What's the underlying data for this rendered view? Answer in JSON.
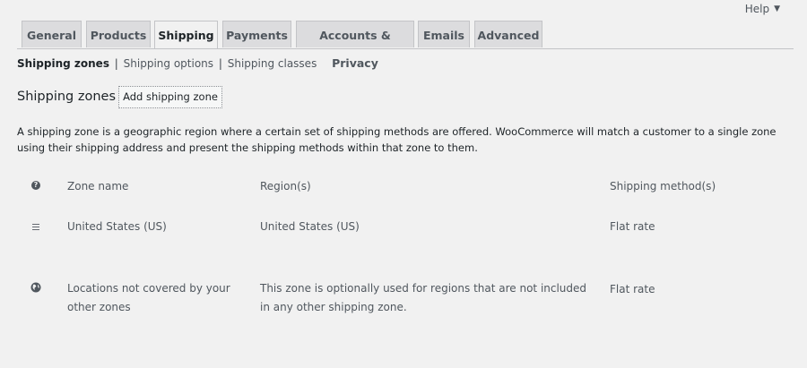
{
  "help": {
    "label": "Help"
  },
  "tabs": [
    {
      "label": "General",
      "active": false
    },
    {
      "label": "Products",
      "active": false
    },
    {
      "label": "Shipping",
      "active": true
    },
    {
      "label": "Payments",
      "active": false
    },
    {
      "label": "Accounts & Privacy",
      "active": false
    },
    {
      "label": "Emails",
      "active": false
    },
    {
      "label": "Advanced",
      "active": false
    }
  ],
  "subnav": [
    {
      "label": "Shipping zones",
      "current": true
    },
    {
      "label": "Shipping options",
      "current": false
    },
    {
      "label": "Shipping classes",
      "current": false
    }
  ],
  "subnav_separator": "|",
  "page": {
    "heading": "Shipping zones",
    "add_button": "Add shipping zone",
    "description": "A shipping zone is a geographic region where a certain set of shipping methods are offered. WooCommerce will match a customer to a single zone using their shipping address and present the shipping methods within that zone to them."
  },
  "table": {
    "help_icon_glyph": "?",
    "headers": {
      "name": "Zone name",
      "regions": "Region(s)",
      "methods": "Shipping method(s)"
    },
    "rows": [
      {
        "name": "United States (US)",
        "regions": "United States (US)",
        "methods": "Flat rate",
        "icon": "drag-handle-icon"
      },
      {
        "name": "Locations not covered by your other zones",
        "regions": "This zone is optionally used for regions that are not included in any other shipping zone.",
        "methods": "Flat rate",
        "icon": "globe-icon"
      }
    ]
  },
  "colors": {
    "background": "#f1f1f1",
    "tab_inactive": "#dcdcde",
    "text": "#50575e"
  }
}
